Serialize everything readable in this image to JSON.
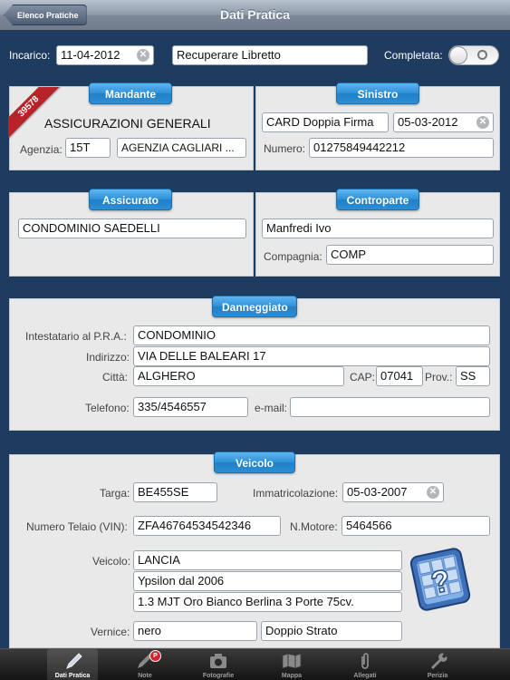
{
  "nav": {
    "back_label": "Elenco Pratiche",
    "title": "Dati Pratica"
  },
  "top": {
    "incarico_label": "Incarico:",
    "incarico_value": "11-04-2012",
    "task_value": "Recuperare Libretto",
    "completata_label": "Completata:",
    "completata_on": false
  },
  "mandante": {
    "title": "Mandante",
    "ribbon": "39578",
    "company": "ASSICURAZIONI GENERALI",
    "agenzia_label": "Agenzia:",
    "agenzia_code": "15T",
    "agenzia_name": "AGENZIA CAGLIARI ..."
  },
  "sinistro": {
    "title": "Sinistro",
    "type": "CARD Doppia Firma",
    "date": "05-03-2012",
    "numero_label": "Numero:",
    "numero": "01275849442212"
  },
  "assicurato": {
    "title": "Assicurato",
    "name": "CONDOMINIO SAEDELLI"
  },
  "controparte": {
    "title": "Controparte",
    "name": "Manfredi Ivo",
    "compagnia_label": "Compagnia:",
    "compagnia": "COMP"
  },
  "danneggiato": {
    "title": "Danneggiato",
    "intestatario_label": "Intestatario al P.R.A.:",
    "intestatario": "CONDOMINIO",
    "indirizzo_label": "Indirizzo:",
    "indirizzo": "VIA DELLE BALEARI 17",
    "citta_label": "Città:",
    "citta": "ALGHERO",
    "cap_label": "CAP:",
    "cap": "07041",
    "prov_label": "Prov.:",
    "prov": "SS",
    "telefono_label": "Telefono:",
    "telefono": "335/4546557",
    "email_label": "e-mail:",
    "email": ""
  },
  "veicolo": {
    "title": "Veicolo",
    "targa_label": "Targa:",
    "targa": "BE455SE",
    "immatricolazione_label": "Immatricolazione:",
    "immatricolazione": "05-03-2007",
    "telaio_label": "Numero Telaio (VIN):",
    "telaio": "ZFA46764534542346",
    "motore_label": "N.Motore:",
    "motore": "5464566",
    "veicolo_label": "Veicolo:",
    "marca": "LANCIA",
    "modello": "Ypsilon dal 2006",
    "versione": "1.3 MJT Oro Bianco Berlina 3 Porte 75cv.",
    "vernice_label": "Vernice:",
    "vernice": "nero",
    "strato": "Doppio Strato"
  },
  "tabs": [
    {
      "label": "Dati Pratica",
      "icon": "pencil-icon",
      "active": true
    },
    {
      "label": "Note",
      "icon": "pen-note-icon",
      "badge": "P"
    },
    {
      "label": "Fotografie",
      "icon": "camera-icon"
    },
    {
      "label": "Mappa",
      "icon": "map-icon"
    },
    {
      "label": "Allegati",
      "icon": "paperclip-icon"
    },
    {
      "label": "Perizia",
      "icon": "wrench-icon"
    }
  ],
  "colors": {
    "background": "#1e3b60",
    "panel": "#e9e9ea",
    "accent": "#2f8fd6",
    "ribbon": "#b8232a"
  }
}
